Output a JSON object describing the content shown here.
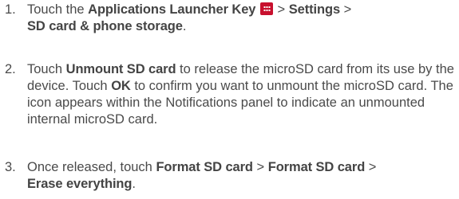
{
  "steps": [
    {
      "number": "1.",
      "parts": {
        "t1": "Touch the ",
        "b1": "Applications Launcher Key",
        "t2": " > ",
        "b2": "Settings",
        "t3": " > ",
        "b3": "SD card & phone storage",
        "t4": "."
      },
      "icon": "applications-launcher-key-icon"
    },
    {
      "number": "2.",
      "parts": {
        "t1": "Touch ",
        "b1": "Unmount SD card",
        "t2": " to release the microSD card from its use by the device. Touch ",
        "b2": "OK",
        "t3": " to confirm you want to unmount the microSD card. The icon appears within the Notifications panel to indicate an unmounted internal microSD card."
      }
    },
    {
      "number": "3.",
      "parts": {
        "t1": "Once released, touch ",
        "b1": "Format SD card",
        "t2": " > ",
        "b2": "Format SD card",
        "t3": " > ",
        "b3": "Erase everything",
        "t4": "."
      }
    }
  ],
  "colors": {
    "text": "#4a4a4a",
    "icon_red": "#c8102e"
  }
}
